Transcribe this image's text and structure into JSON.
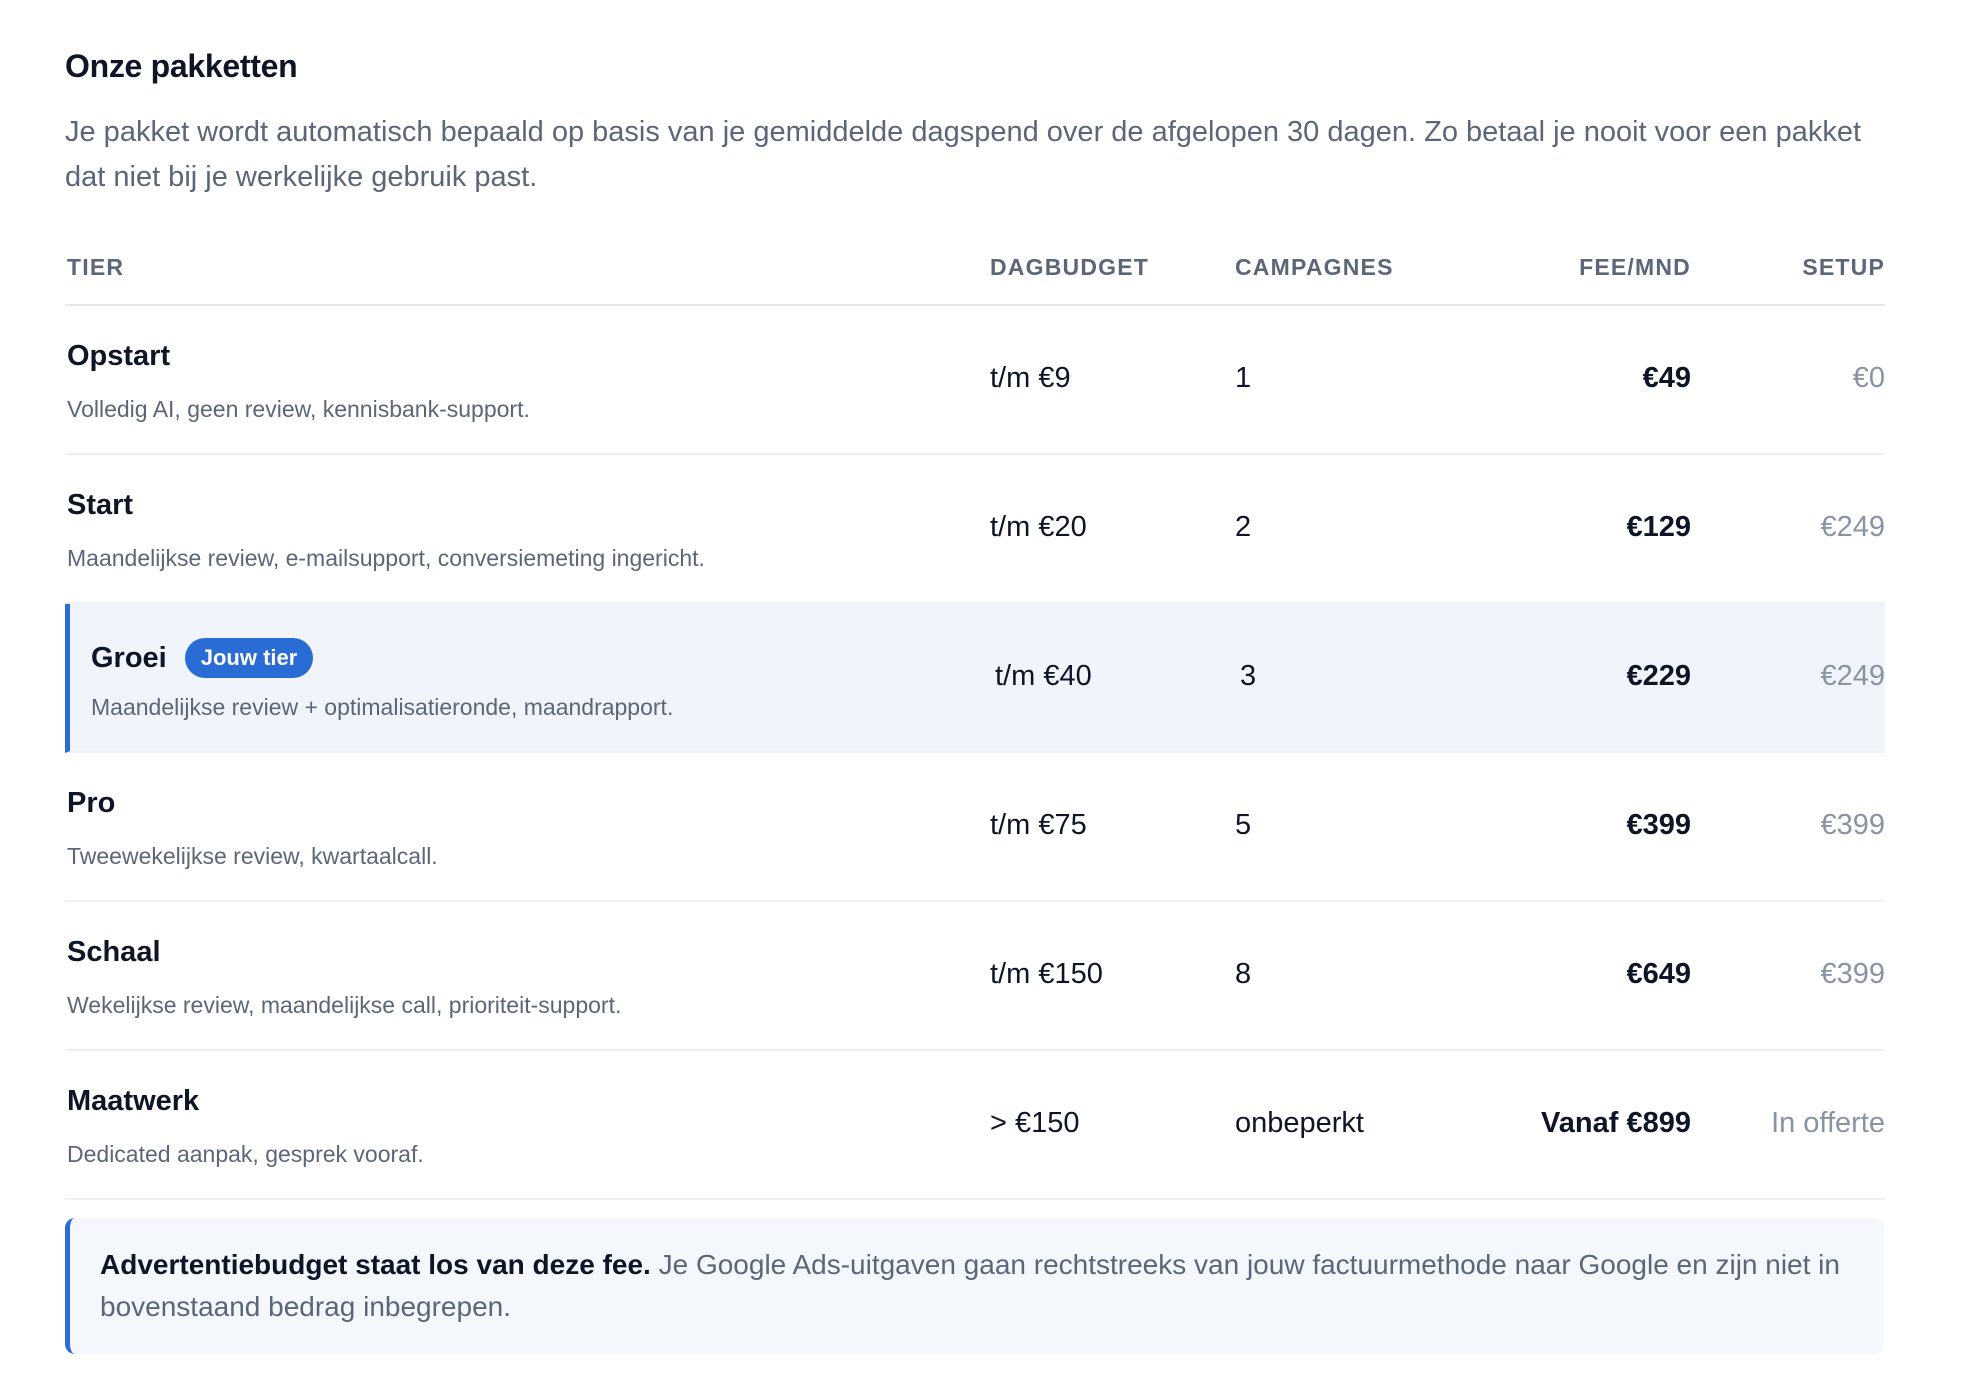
{
  "title": "Onze pakketten",
  "intro": "Je pakket wordt automatisch bepaald op basis van je gemiddelde dagspend over de afgelopen 30 dagen. Zo betaal je nooit voor een pakket dat niet bij je werkelijke gebruik past.",
  "table": {
    "headers": {
      "tier": "TIER",
      "budget": "DAGBUDGET",
      "campaigns": "CAMPAGNES",
      "fee": "FEE/MND",
      "setup": "SETUP"
    },
    "rows": [
      {
        "name": "Opstart",
        "desc": "Volledig AI, geen review, kennisbank-support.",
        "budget": "t/m €9",
        "campaigns": "1",
        "fee": "€49",
        "setup": "€0"
      },
      {
        "name": "Start",
        "desc": "Maandelijkse review, e-mailsupport, conversiemeting ingericht.",
        "budget": "t/m €20",
        "campaigns": "2",
        "fee": "€129",
        "setup": "€249"
      },
      {
        "name": "Groei",
        "badge": "Jouw tier",
        "desc": "Maandelijkse review + optimalisatieronde, maandrapport.",
        "budget": "t/m €40",
        "campaigns": "3",
        "fee": "€229",
        "setup": "€249"
      },
      {
        "name": "Pro",
        "desc": "Tweewekelijkse review, kwartaalcall.",
        "budget": "t/m €75",
        "campaigns": "5",
        "fee": "€399",
        "setup": "€399"
      },
      {
        "name": "Schaal",
        "desc": "Wekelijkse review, maandelijkse call, prioriteit-support.",
        "budget": "t/m €150",
        "campaigns": "8",
        "fee": "€649",
        "setup": "€399"
      },
      {
        "name": "Maatwerk",
        "desc": "Dedicated aanpak, gesprek vooraf.",
        "budget": "> €150",
        "campaigns": "onbeperkt",
        "fee": "Vanaf €899",
        "setup": "In offerte"
      }
    ]
  },
  "note": {
    "bold": "Advertentiebudget staat los van deze fee.",
    "text": " Je Google Ads-uitgaven gaan rechtstreeks van jouw factuurmethode naar Google en zijn niet in bovenstaand bedrag inbegrepen."
  },
  "colors": {
    "accent": "#2a6cd6",
    "highlight_bg": "#f1f5fb",
    "muted_text": "#5b6678"
  }
}
